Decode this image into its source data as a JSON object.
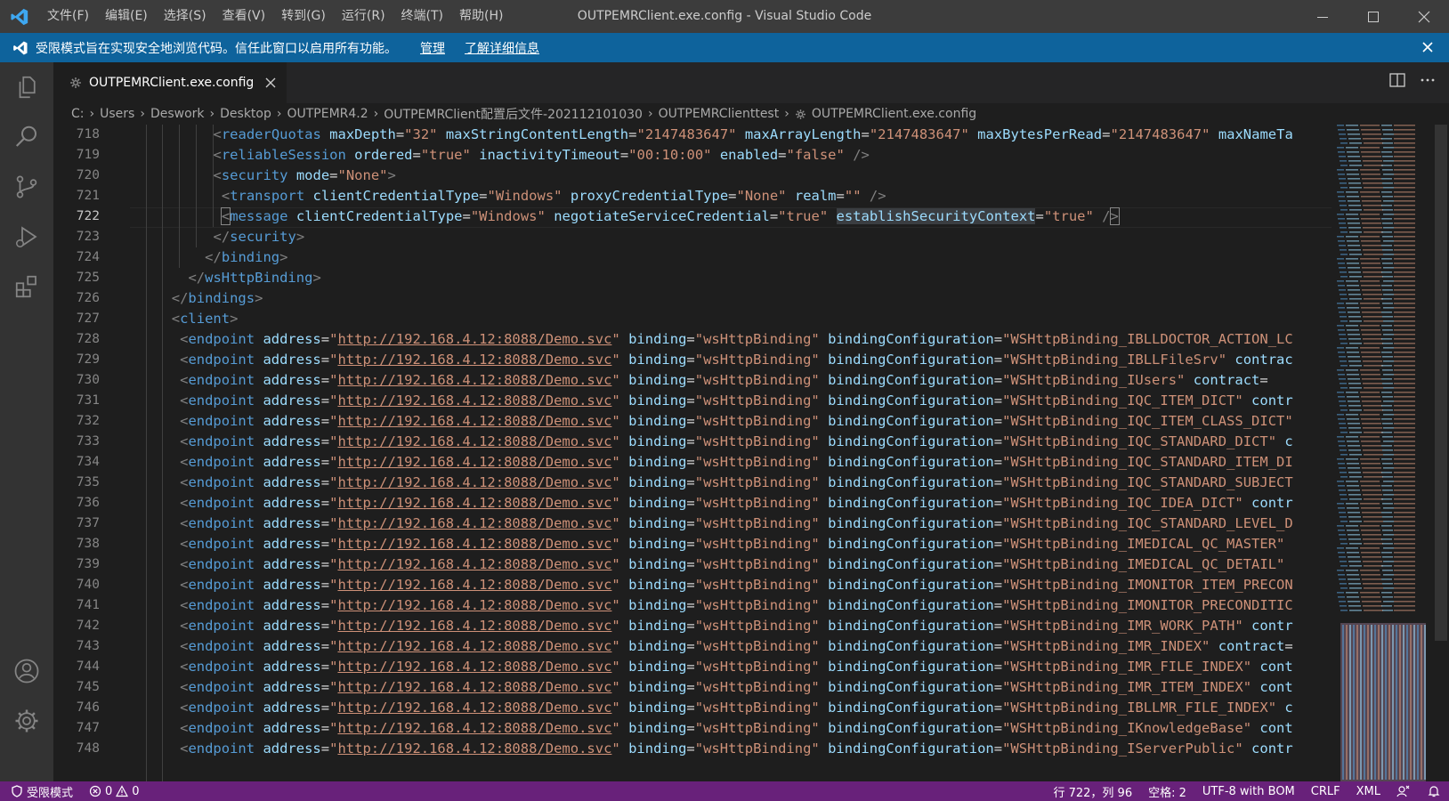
{
  "window": {
    "title": "OUTPEMRClient.exe.config - Visual Studio Code",
    "menu": [
      "文件(F)",
      "编辑(E)",
      "选择(S)",
      "查看(V)",
      "转到(G)",
      "运行(R)",
      "终端(T)",
      "帮助(H)"
    ]
  },
  "banner": {
    "message": "受限模式旨在实现安全地浏览代码。信任此窗口以启用所有功能。",
    "manage_label": "管理",
    "learn_more_label": "了解详细信息"
  },
  "tab": {
    "label": "OUTPEMRClient.exe.config"
  },
  "breadcrumb": [
    "C:",
    "Users",
    "Deswork",
    "Desktop",
    "OUTPEMR4.2",
    "OUTPEMRClient配置后文件-202112101030",
    "OUTPEMRClienttest",
    "OUTPEMRClient.exe.config"
  ],
  "editor": {
    "line_numbers": [
      "718",
      "719",
      "720",
      "721",
      "722",
      "723",
      "724",
      "725",
      "726",
      "727",
      "728",
      "729",
      "730",
      "731",
      "732",
      "733",
      "734",
      "735",
      "736",
      "737",
      "738",
      "739",
      "740",
      "741",
      "742",
      "743",
      "744",
      "745",
      "746",
      "747",
      "748"
    ],
    "active_line": "722",
    "lines": [
      [
        [
          "p",
          "<"
        ],
        [
          "t",
          "readerQuotas"
        ],
        [
          "s",
          " "
        ],
        [
          "a",
          "maxDepth"
        ],
        [
          "e",
          "="
        ],
        [
          "v",
          "\"32\""
        ],
        [
          "s",
          " "
        ],
        [
          "a",
          "maxStringContentLength"
        ],
        [
          "e",
          "="
        ],
        [
          "v",
          "\"2147483647\""
        ],
        [
          "s",
          " "
        ],
        [
          "a",
          "maxArrayLength"
        ],
        [
          "e",
          "="
        ],
        [
          "v",
          "\"2147483647\""
        ],
        [
          "s",
          " "
        ],
        [
          "a",
          "maxBytesPerRead"
        ],
        [
          "e",
          "="
        ],
        [
          "v",
          "\"2147483647\""
        ],
        [
          "s",
          " "
        ],
        [
          "a",
          "maxNameTa"
        ]
      ],
      [
        [
          "p",
          "<"
        ],
        [
          "t",
          "reliableSession"
        ],
        [
          "s",
          " "
        ],
        [
          "a",
          "ordered"
        ],
        [
          "e",
          "="
        ],
        [
          "v",
          "\"true\""
        ],
        [
          "s",
          " "
        ],
        [
          "a",
          "inactivityTimeout"
        ],
        [
          "e",
          "="
        ],
        [
          "v",
          "\"00:10:00\""
        ],
        [
          "s",
          " "
        ],
        [
          "a",
          "enabled"
        ],
        [
          "e",
          "="
        ],
        [
          "v",
          "\"false\""
        ],
        [
          "s",
          " "
        ],
        [
          "p",
          "/>"
        ]
      ],
      [
        [
          "p",
          "<"
        ],
        [
          "t",
          "security"
        ],
        [
          "s",
          " "
        ],
        [
          "a",
          "mode"
        ],
        [
          "e",
          "="
        ],
        [
          "v",
          "\"None\""
        ],
        [
          "p",
          ">"
        ]
      ],
      [
        [
          "p",
          "<"
        ],
        [
          "t",
          "transport"
        ],
        [
          "s",
          " "
        ],
        [
          "a",
          "clientCredentialType"
        ],
        [
          "e",
          "="
        ],
        [
          "v",
          "\"Windows\""
        ],
        [
          "s",
          " "
        ],
        [
          "a",
          "proxyCredentialType"
        ],
        [
          "e",
          "="
        ],
        [
          "v",
          "\"None\""
        ],
        [
          "s",
          " "
        ],
        [
          "a",
          "realm"
        ],
        [
          "e",
          "="
        ],
        [
          "v",
          "\"\""
        ],
        [
          "s",
          " "
        ],
        [
          "p",
          "/>"
        ]
      ],
      [
        [
          "b",
          "<"
        ],
        [
          "t",
          "message"
        ],
        [
          "s",
          " "
        ],
        [
          "a",
          "clientCredentialType"
        ],
        [
          "e",
          "="
        ],
        [
          "v",
          "\"Windows\""
        ],
        [
          "s",
          " "
        ],
        [
          "a",
          "negotiateServiceCredential"
        ],
        [
          "e",
          "="
        ],
        [
          "v",
          "\"true\""
        ],
        [
          "s",
          " "
        ],
        [
          "h",
          "establishSecurityContext"
        ],
        [
          "e",
          "="
        ],
        [
          "v",
          "\"true\""
        ],
        [
          "s",
          " "
        ],
        [
          "p",
          "/"
        ],
        [
          "b",
          ">"
        ]
      ],
      [
        [
          "p",
          "</"
        ],
        [
          "t",
          "security"
        ],
        [
          "p",
          ">"
        ]
      ],
      [
        [
          "p",
          "</"
        ],
        [
          "t",
          "binding"
        ],
        [
          "p",
          ">"
        ]
      ],
      [
        [
          "p",
          "</"
        ],
        [
          "t",
          "wsHttpBinding"
        ],
        [
          "p",
          ">"
        ]
      ],
      [
        [
          "p",
          "</"
        ],
        [
          "t",
          "bindings"
        ],
        [
          "p",
          ">"
        ]
      ],
      [
        [
          "p",
          "<"
        ],
        [
          "t",
          "client"
        ],
        [
          "p",
          ">"
        ]
      ],
      "endpoint:WSHttpBinding_IBLLDOCTOR_ACTION_LC",
      "endpoint:WSHttpBinding_IBLLFileSrv\" contrac",
      "endpoint:WSHttpBinding_IUsers\" contract=\"Cl",
      "endpoint:WSHttpBinding_IQC_ITEM_DICT\" contr",
      "endpoint:WSHttpBinding_IQC_ITEM_CLASS_DICT\"",
      "endpoint:WSHttpBinding_IQC_STANDARD_DICT\" c",
      "endpoint:WSHttpBinding_IQC_STANDARD_ITEM_DI",
      "endpoint:WSHttpBinding_IQC_STANDARD_SUBJECT",
      "endpoint:WSHttpBinding_IQC_IDEA_DICT\" contr",
      "endpoint:WSHttpBinding_IQC_STANDARD_LEVEL_D",
      "endpoint:WSHttpBinding_IMEDICAL_QC_MASTER\"",
      "endpoint:WSHttpBinding_IMEDICAL_QC_DETAIL\"",
      "endpoint:WSHttpBinding_IMONITOR_ITEM_PRECON",
      "endpoint:WSHttpBinding_IMONITOR_PRECONDITIC",
      "endpoint:WSHttpBinding_IMR_WORK_PATH\" contr",
      "endpoint:WSHttpBinding_IMR_INDEX\" contract=",
      "endpoint:WSHttpBinding_IMR_FILE_INDEX\" cont",
      "endpoint:WSHttpBinding_IMR_ITEM_INDEX\" cont",
      "endpoint:WSHttpBinding_IBLLMR_FILE_INDEX\" c",
      "endpoint:WSHttpBinding_IKnowledgeBase\" cont",
      "endpoint:WSHttpBinding_IServerPublic\" contr"
    ],
    "endpoint": {
      "tag": "endpoint",
      "address_attr": "address",
      "url": "http://192.168.4.12:8088/Demo.svc",
      "binding_attr": "binding",
      "binding_val": "\"wsHttpBinding\"",
      "config_attr": "bindingConfiguration"
    }
  },
  "statusbar": {
    "restricted": "受限模式",
    "errors": "0",
    "warnings": "0",
    "position": "行 722，列 96",
    "indent": "空格: 2",
    "encoding": "UTF-8 with BOM",
    "eol": "CRLF",
    "language": "XML"
  },
  "colors": {
    "titlebar": "#3c3c3c",
    "banner": "#0e639c",
    "statusbar": "#68217a",
    "tag": "#569cd6",
    "attribute": "#9cdcfe",
    "string": "#ce9178"
  },
  "icons": {
    "activity": [
      "explorer-icon",
      "search-icon",
      "source-control-icon",
      "run-debug-icon",
      "extensions-icon",
      "account-icon",
      "settings-gear-icon"
    ]
  }
}
